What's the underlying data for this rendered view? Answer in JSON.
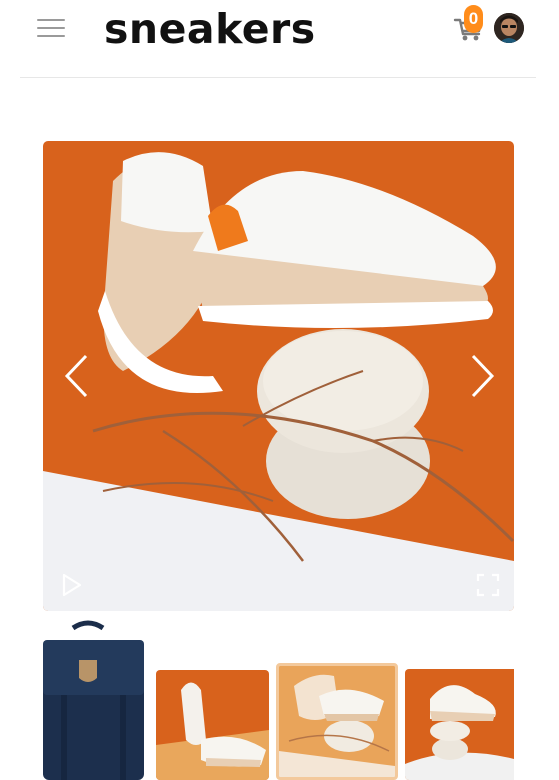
{
  "header": {
    "brand": "sneakers",
    "cart_count": "0",
    "menu_icon": "hamburger-icon",
    "cart_icon": "shopping-cart-icon"
  },
  "gallery": {
    "current_index": 3,
    "total_thumbnails": 4,
    "controls": [
      "chevron-left-icon",
      "chevron-right-icon",
      "play-icon",
      "fullscreen-icon"
    ]
  },
  "colors": {
    "brand_text": "#111111",
    "accent": "#ff8c1a",
    "backdrop_orange": "#d8621c",
    "thumb_active_border": "#f3c99c"
  }
}
